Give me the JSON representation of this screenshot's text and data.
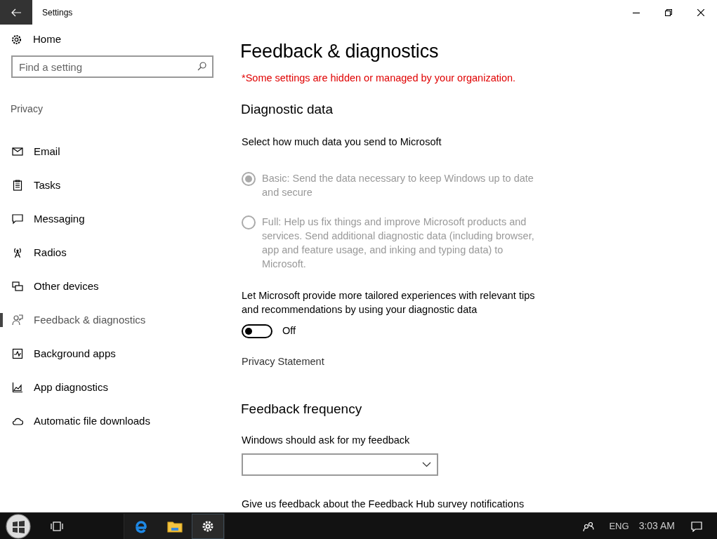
{
  "window": {
    "title": "Settings"
  },
  "sidebar": {
    "home": "Home",
    "search": {
      "placeholder": "Find a setting"
    },
    "section": "Privacy",
    "items": [
      {
        "label": "Email",
        "selected": false
      },
      {
        "label": "Tasks",
        "selected": false
      },
      {
        "label": "Messaging",
        "selected": false
      },
      {
        "label": "Radios",
        "selected": false
      },
      {
        "label": "Other devices",
        "selected": false
      },
      {
        "label": "Feedback & diagnostics",
        "selected": true
      },
      {
        "label": "Background apps",
        "selected": false
      },
      {
        "label": "App diagnostics",
        "selected": false
      },
      {
        "label": "Automatic file downloads",
        "selected": false
      }
    ]
  },
  "content": {
    "title": "Feedback & diagnostics",
    "warning": "*Some settings are hidden or managed by your organization.",
    "diagnostic_heading": "Diagnostic data",
    "diagnostic_prompt": "Select how much data you send to Microsoft",
    "options": [
      {
        "label": "Basic: Send the data necessary to keep Windows up to date and secure",
        "selected": true,
        "disabled": true
      },
      {
        "label": "Full: Help us fix things and improve Microsoft products and services. Send additional diagnostic data (including browser, app and feature usage, and inking and typing data) to Microsoft.",
        "selected": false,
        "disabled": true
      }
    ],
    "tailored": {
      "label": "Let Microsoft provide more tailored experiences with relevant tips and recommendations by using your diagnostic data",
      "on": false,
      "state": "Off"
    },
    "privacy_link": "Privacy Statement",
    "frequency_heading": "Feedback frequency",
    "frequency_label": "Windows should ask for my feedback",
    "hub_text": "Give us feedback about the Feedback Hub survey notifications"
  },
  "taskbar": {
    "language": "ENG",
    "time": "3:03 AM"
  }
}
